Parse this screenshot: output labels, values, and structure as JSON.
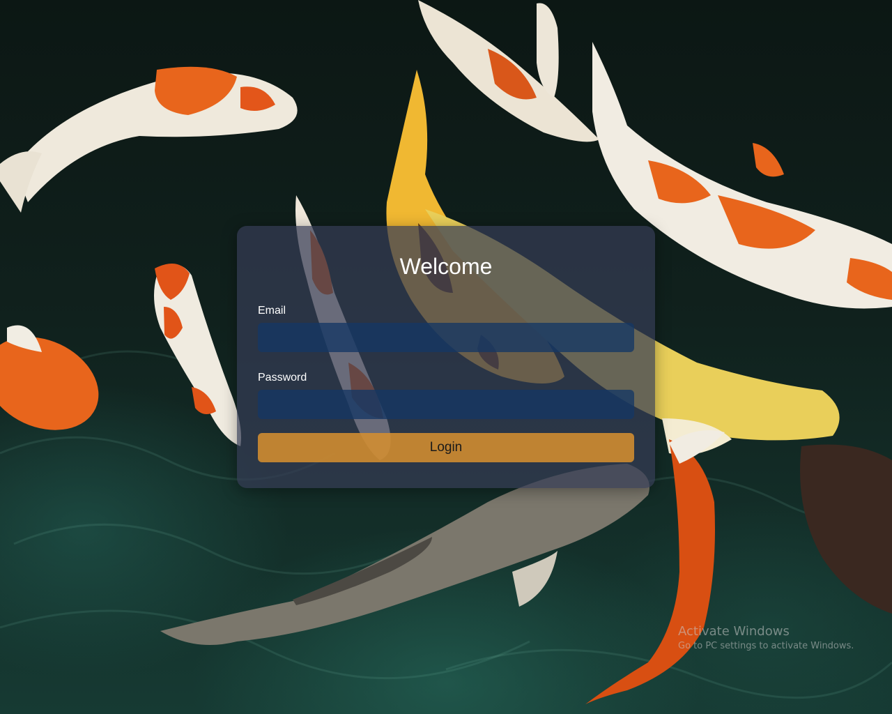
{
  "background": {
    "description_icon": "koi-pond-photo",
    "water_color": "#10211d",
    "koi_colors": [
      "#e8651c",
      "#f2efe6",
      "#f0b832",
      "#e6cf55",
      "#7a776e",
      "#d84f12"
    ]
  },
  "login": {
    "title": "Welcome",
    "email_label": "Email",
    "email_value": "",
    "password_label": "Password",
    "password_value": "",
    "submit_label": "Login",
    "accent_color": "#d48e30",
    "input_color": "#143764"
  },
  "watermark": {
    "title": "Activate Windows",
    "subtitle": "Go to PC settings to activate Windows."
  }
}
